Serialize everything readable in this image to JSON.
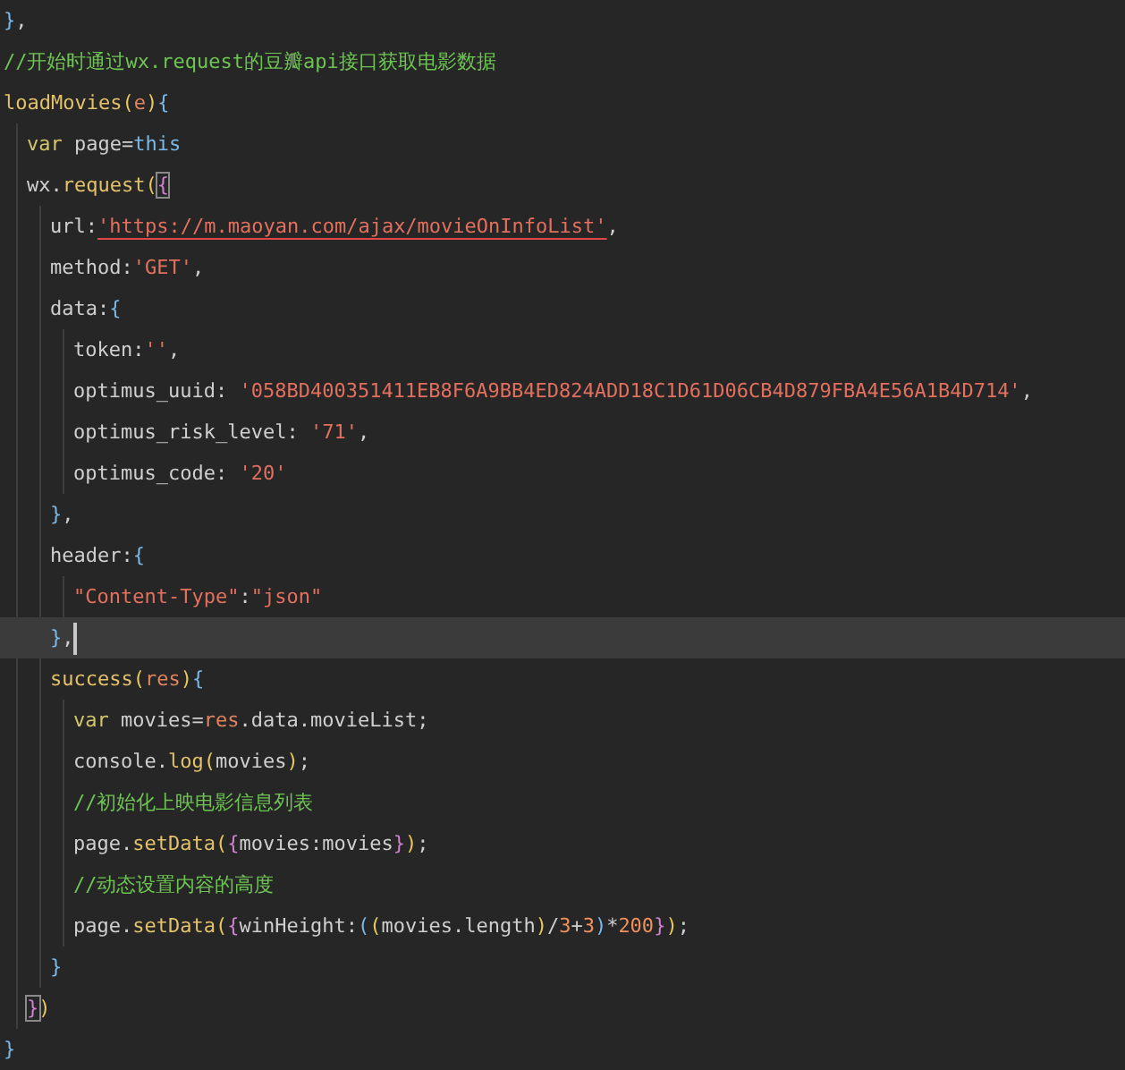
{
  "editor": {
    "lines": [
      {
        "tokens": [
          {
            "kind": "brace-c",
            "text": "}"
          },
          {
            "kind": "punct",
            "text": ","
          }
        ]
      },
      {
        "tokens": [
          {
            "kind": "comment",
            "text": "//开始时通过wx.request的豆瓣api接口获取电影数据"
          }
        ]
      },
      {
        "tokens": [
          {
            "kind": "func",
            "text": "loadMovies"
          },
          {
            "kind": "brace-a",
            "text": "("
          },
          {
            "kind": "param",
            "text": "e"
          },
          {
            "kind": "brace-a",
            "text": ")"
          },
          {
            "kind": "brace-c",
            "text": "{"
          }
        ],
        "children": [
          {
            "tokens": [
              {
                "kind": "keyword",
                "text": "var"
              },
              {
                "kind": "plain",
                "text": " page="
              },
              {
                "kind": "this",
                "text": "this"
              }
            ]
          },
          {
            "tokens": [
              {
                "kind": "plain",
                "text": "wx."
              },
              {
                "kind": "func",
                "text": "request"
              },
              {
                "kind": "brace-a",
                "text": "("
              },
              {
                "kind": "brace-b",
                "text": "{",
                "boxed": true
              }
            ],
            "children": [
              {
                "tokens": [
                  {
                    "kind": "plain",
                    "text": "url:"
                  },
                  {
                    "kind": "url",
                    "text": "'https://m.maoyan.com/ajax/movieOnInfoList'"
                  },
                  {
                    "kind": "punct",
                    "text": ","
                  }
                ]
              },
              {
                "tokens": [
                  {
                    "kind": "plain",
                    "text": "method:"
                  },
                  {
                    "kind": "string",
                    "text": "'GET'"
                  },
                  {
                    "kind": "punct",
                    "text": ","
                  }
                ]
              },
              {
                "tokens": [
                  {
                    "kind": "plain",
                    "text": "data:"
                  },
                  {
                    "kind": "brace-c",
                    "text": "{"
                  }
                ],
                "children": [
                  {
                    "tokens": [
                      {
                        "kind": "plain",
                        "text": "token:"
                      },
                      {
                        "kind": "string",
                        "text": "''"
                      },
                      {
                        "kind": "punct",
                        "text": ","
                      }
                    ]
                  },
                  {
                    "tokens": [
                      {
                        "kind": "plain",
                        "text": "optimus_uuid: "
                      },
                      {
                        "kind": "string",
                        "text": "'058BD400351411EB8F6A9BB4ED824ADD18C1D61D06CB4D879FBA4E56A1B4D714'"
                      },
                      {
                        "kind": "punct",
                        "text": ","
                      }
                    ]
                  },
                  {
                    "tokens": [
                      {
                        "kind": "plain",
                        "text": "optimus_risk_level: "
                      },
                      {
                        "kind": "string",
                        "text": "'71'"
                      },
                      {
                        "kind": "punct",
                        "text": ","
                      }
                    ]
                  },
                  {
                    "tokens": [
                      {
                        "kind": "plain",
                        "text": "optimus_code: "
                      },
                      {
                        "kind": "string",
                        "text": "'20'"
                      }
                    ]
                  }
                ]
              },
              {
                "tokens": [
                  {
                    "kind": "brace-c",
                    "text": "}"
                  },
                  {
                    "kind": "punct",
                    "text": ","
                  }
                ]
              },
              {
                "tokens": [
                  {
                    "kind": "plain",
                    "text": "header:"
                  },
                  {
                    "kind": "brace-c",
                    "text": "{"
                  }
                ],
                "children": [
                  {
                    "tokens": [
                      {
                        "kind": "string",
                        "text": "\"Content-Type\""
                      },
                      {
                        "kind": "plain",
                        "text": ":"
                      },
                      {
                        "kind": "string",
                        "text": "\"json\""
                      }
                    ]
                  }
                ]
              },
              {
                "tokens": [
                  {
                    "kind": "brace-c",
                    "text": "}"
                  },
                  {
                    "kind": "punct",
                    "text": ","
                  }
                ],
                "current": true
              },
              {
                "tokens": [
                  {
                    "kind": "func",
                    "text": "success"
                  },
                  {
                    "kind": "brace-a",
                    "text": "("
                  },
                  {
                    "kind": "param",
                    "text": "res"
                  },
                  {
                    "kind": "brace-a",
                    "text": ")"
                  },
                  {
                    "kind": "brace-c",
                    "text": "{"
                  }
                ],
                "children": [
                  {
                    "tokens": [
                      {
                        "kind": "keyword",
                        "text": "var"
                      },
                      {
                        "kind": "plain",
                        "text": " movies="
                      },
                      {
                        "kind": "param",
                        "text": "res"
                      },
                      {
                        "kind": "plain",
                        "text": ".data.movieList;"
                      }
                    ]
                  },
                  {
                    "tokens": [
                      {
                        "kind": "plain",
                        "text": "console."
                      },
                      {
                        "kind": "func",
                        "text": "log"
                      },
                      {
                        "kind": "brace-a",
                        "text": "("
                      },
                      {
                        "kind": "plain",
                        "text": "movies"
                      },
                      {
                        "kind": "brace-a",
                        "text": ")"
                      },
                      {
                        "kind": "punct",
                        "text": ";"
                      }
                    ]
                  },
                  {
                    "tokens": [
                      {
                        "kind": "comment",
                        "text": "//初始化上映电影信息列表"
                      }
                    ]
                  },
                  {
                    "tokens": [
                      {
                        "kind": "plain",
                        "text": "page."
                      },
                      {
                        "kind": "func",
                        "text": "setData"
                      },
                      {
                        "kind": "brace-a",
                        "text": "("
                      },
                      {
                        "kind": "brace-b",
                        "text": "{"
                      },
                      {
                        "kind": "plain",
                        "text": "movies:movies"
                      },
                      {
                        "kind": "brace-b",
                        "text": "}"
                      },
                      {
                        "kind": "brace-a",
                        "text": ")"
                      },
                      {
                        "kind": "punct",
                        "text": ";"
                      }
                    ]
                  },
                  {
                    "tokens": [
                      {
                        "kind": "comment",
                        "text": "//动态设置内容的高度"
                      }
                    ]
                  },
                  {
                    "tokens": [
                      {
                        "kind": "plain",
                        "text": "page."
                      },
                      {
                        "kind": "func",
                        "text": "setData"
                      },
                      {
                        "kind": "brace-a",
                        "text": "("
                      },
                      {
                        "kind": "brace-b",
                        "text": "{"
                      },
                      {
                        "kind": "plain",
                        "text": "winHeight:"
                      },
                      {
                        "kind": "brace-c",
                        "text": "("
                      },
                      {
                        "kind": "brace-a",
                        "text": "("
                      },
                      {
                        "kind": "plain",
                        "text": "movies.length"
                      },
                      {
                        "kind": "brace-a",
                        "text": ")"
                      },
                      {
                        "kind": "plain",
                        "text": "/"
                      },
                      {
                        "kind": "number",
                        "text": "3"
                      },
                      {
                        "kind": "plain",
                        "text": "+"
                      },
                      {
                        "kind": "number",
                        "text": "3"
                      },
                      {
                        "kind": "brace-c",
                        "text": ")"
                      },
                      {
                        "kind": "plain",
                        "text": "*"
                      },
                      {
                        "kind": "number",
                        "text": "200"
                      },
                      {
                        "kind": "brace-b",
                        "text": "}"
                      },
                      {
                        "kind": "brace-a",
                        "text": ")"
                      },
                      {
                        "kind": "punct",
                        "text": ";"
                      }
                    ]
                  }
                ]
              },
              {
                "tokens": [
                  {
                    "kind": "brace-c",
                    "text": "}"
                  }
                ]
              }
            ]
          },
          {
            "tokens": [
              {
                "kind": "brace-b",
                "text": "}",
                "boxed": true
              },
              {
                "kind": "brace-a",
                "text": ")"
              }
            ]
          }
        ]
      },
      {
        "tokens": [
          {
            "kind": "brace-c",
            "text": "}"
          }
        ]
      }
    ]
  }
}
